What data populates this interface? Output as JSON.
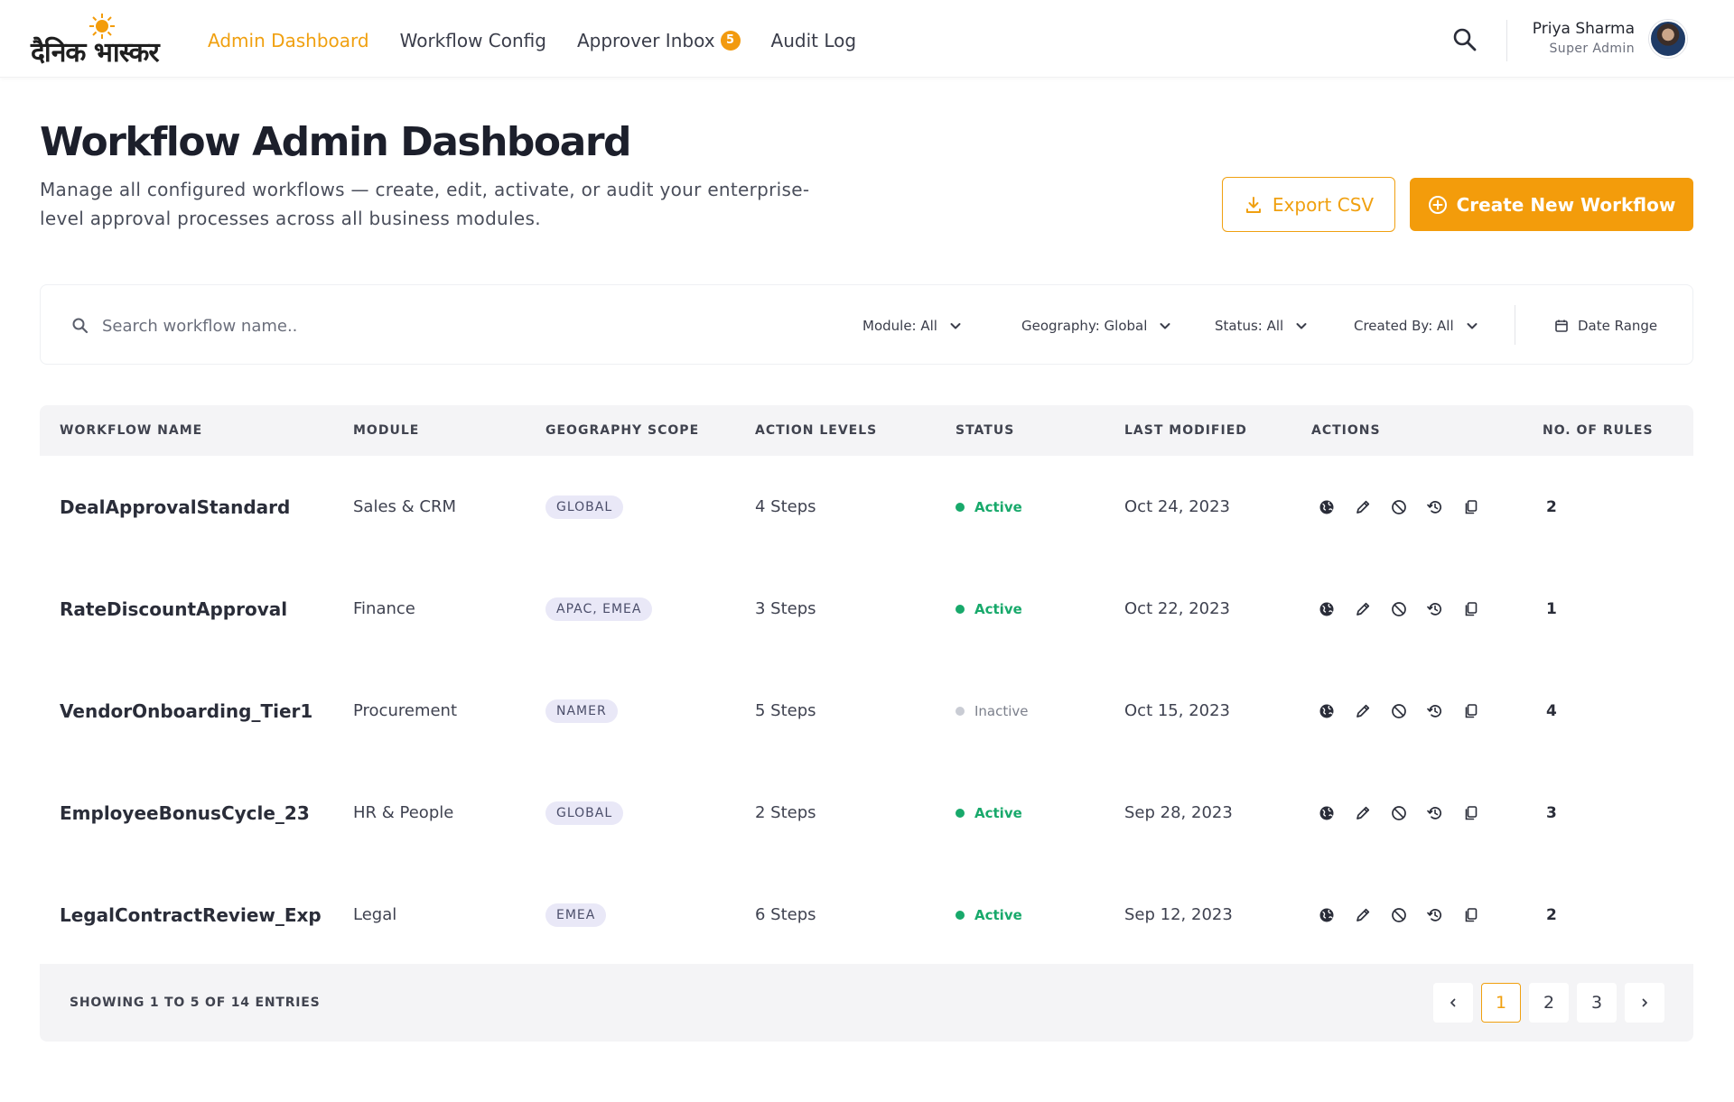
{
  "brand": {
    "logo_text": "दैनिक भास्कर",
    "accent": "#f39c0b"
  },
  "nav": {
    "links": [
      {
        "label": "Admin Dashboard",
        "active": true
      },
      {
        "label": "Workflow Config",
        "active": false
      },
      {
        "label": "Approver Inbox",
        "active": false,
        "badge": "5"
      },
      {
        "label": "Audit Log",
        "active": false
      }
    ]
  },
  "user": {
    "name": "Priya Sharma",
    "role": "Super Admin"
  },
  "header": {
    "title": "Workflow Admin Dashboard",
    "subtitle": "Manage all configured workflows — create, edit, activate, or audit your enterprise-level approval processes across all business modules.",
    "export_label": "Export CSV",
    "create_label": "Create New Workflow"
  },
  "filters": {
    "search_placeholder": "Search workflow name..",
    "module": "Module: All",
    "geography": "Geography: Global",
    "status": "Status: All",
    "created_by": "Created By: All",
    "date_range": "Date Range"
  },
  "table": {
    "columns": [
      "WORKFLOW NAME",
      "MODULE",
      "GEOGRAPHY SCOPE",
      "ACTION LEVELS",
      "STATUS",
      "LAST MODIFIED",
      "ACTIONS",
      "NO. OF RULES"
    ],
    "rows": [
      {
        "name": "DealApprovalStandard",
        "module": "Sales & CRM",
        "geo": "GLOBAL",
        "levels": "4 Steps",
        "status": "Active",
        "modified": "Oct 24, 2023",
        "rules": "2"
      },
      {
        "name": "RateDiscountApproval",
        "module": "Finance",
        "geo": "APAC, EMEA",
        "levels": "3 Steps",
        "status": "Active",
        "modified": "Oct 22, 2023",
        "rules": "1"
      },
      {
        "name": "VendorOnboarding_Tier1",
        "module": "Procurement",
        "geo": "NAMER",
        "levels": "5 Steps",
        "status": "Inactive",
        "modified": "Oct 15, 2023",
        "rules": "4"
      },
      {
        "name": "EmployeeBonusCycle_23",
        "module": "HR & People",
        "geo": "GLOBAL",
        "levels": "2 Steps",
        "status": "Active",
        "modified": "Sep 28, 2023",
        "rules": "3"
      },
      {
        "name": "LegalContractReview_Exp",
        "module": "Legal",
        "geo": "EMEA",
        "levels": "6 Steps",
        "status": "Active",
        "modified": "Sep 12, 2023",
        "rules": "2"
      }
    ],
    "row_action_icons": [
      "globe-icon",
      "edit-pencil-icon",
      "disable-icon",
      "history-icon",
      "copy-icon"
    ],
    "status_colors": {
      "Active": "#18a96b",
      "Inactive": "#c9ccd4"
    }
  },
  "footer": {
    "showing": "SHOWING 1 TO 5 OF 14 ENTRIES",
    "pages": [
      "1",
      "2",
      "3"
    ],
    "current_page": "1"
  }
}
